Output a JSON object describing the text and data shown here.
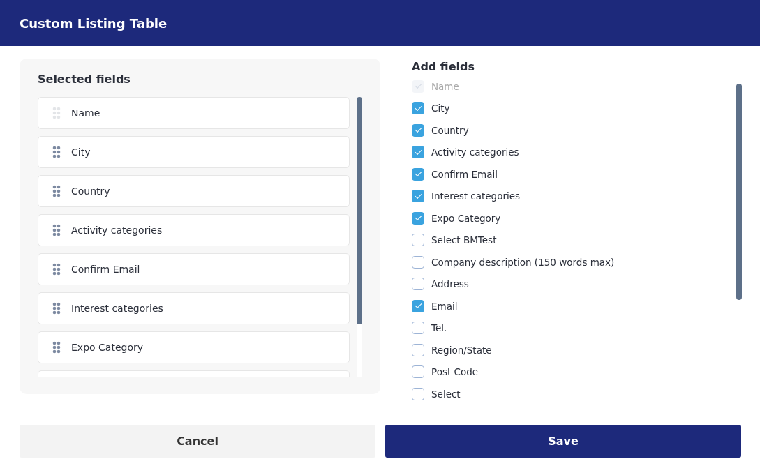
{
  "window": {
    "title": "Custom Listing Table"
  },
  "selected_fields": {
    "title": "Selected fields",
    "items": [
      {
        "label": "Name",
        "disabled": true
      },
      {
        "label": "City",
        "disabled": false
      },
      {
        "label": "Country",
        "disabled": false
      },
      {
        "label": "Activity categories",
        "disabled": false
      },
      {
        "label": "Confirm Email",
        "disabled": false
      },
      {
        "label": "Interest categories",
        "disabled": false
      },
      {
        "label": "Expo Category",
        "disabled": false
      }
    ]
  },
  "add_fields": {
    "title": "Add fields",
    "items": [
      {
        "label": "Name",
        "checked": true,
        "disabled": true
      },
      {
        "label": "City",
        "checked": true,
        "disabled": false
      },
      {
        "label": "Country",
        "checked": true,
        "disabled": false
      },
      {
        "label": "Activity categories",
        "checked": true,
        "disabled": false
      },
      {
        "label": "Confirm Email",
        "checked": true,
        "disabled": false
      },
      {
        "label": "Interest categories",
        "checked": true,
        "disabled": false
      },
      {
        "label": "Expo Category",
        "checked": true,
        "disabled": false
      },
      {
        "label": "Select BMTest",
        "checked": false,
        "disabled": false
      },
      {
        "label": "Company description (150 words max)",
        "checked": false,
        "disabled": false
      },
      {
        "label": "Address",
        "checked": false,
        "disabled": false
      },
      {
        "label": "Email",
        "checked": true,
        "disabled": false
      },
      {
        "label": "Tel.",
        "checked": false,
        "disabled": false
      },
      {
        "label": "Region/State",
        "checked": false,
        "disabled": false
      },
      {
        "label": "Post Code",
        "checked": false,
        "disabled": false
      },
      {
        "label": "Select",
        "checked": false,
        "disabled": false
      }
    ]
  },
  "buttons": [
    {
      "label": "Cancel",
      "kind": "secondary"
    },
    {
      "label": "Save",
      "kind": "primary"
    }
  ]
}
